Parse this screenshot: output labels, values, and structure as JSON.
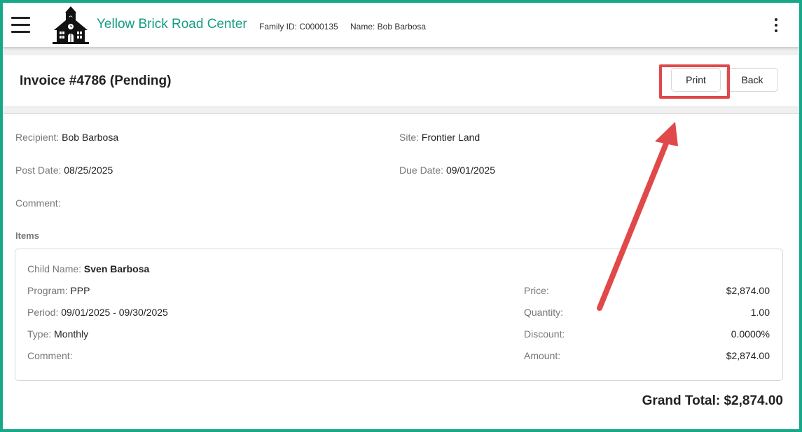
{
  "header": {
    "brand": "Yellow Brick Road Center",
    "family_id": "Family ID: C0000135",
    "family_name": "Name: Bob Barbosa"
  },
  "invoice": {
    "title": "Invoice #4786 (Pending)",
    "print_label": "Print",
    "back_label": "Back"
  },
  "details": {
    "recipient_label": "Recipient",
    "recipient": "Bob Barbosa",
    "site_label": "Site",
    "site": "Frontier Land",
    "post_date_label": "Post Date",
    "post_date": "08/25/2025",
    "due_date_label": "Due Date",
    "due_date": "09/01/2025",
    "comment_label": "Comment",
    "comment": ""
  },
  "items": {
    "heading": "Items",
    "list": [
      {
        "child_name_label": "Child Name",
        "child_name": "Sven Barbosa",
        "program_label": "Program",
        "program": "PPP",
        "period_label": "Period",
        "period": "09/01/2025 - 09/30/2025",
        "type_label": "Type",
        "type": "Monthly",
        "comment_label": "Comment",
        "comment": "",
        "price_label": "Price",
        "price": "$2,874.00",
        "quantity_label": "Quantity",
        "quantity": "1.00",
        "discount_label": "Discount",
        "discount": "0.0000%",
        "amount_label": "Amount",
        "amount": "$2,874.00"
      }
    ]
  },
  "grand_total": "Grand Total: $2,874.00",
  "colors": {
    "brand": "#159c82",
    "frame": "#17a88a",
    "annotation": "#e0484a"
  },
  "icons": {
    "menu": "hamburger-menu-icon",
    "logo": "schoolhouse-icon",
    "more": "kebab-menu-icon"
  }
}
